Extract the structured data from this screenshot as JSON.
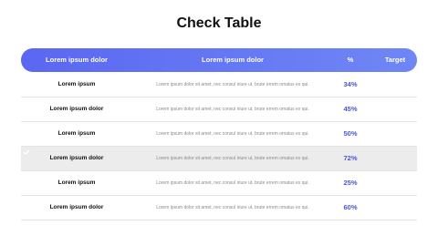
{
  "title": "Check Table",
  "header": {
    "col1": "Lorem ipsum dolor",
    "col2": "Lorem ipsum dolor",
    "col3": "%",
    "col4": "Target"
  },
  "rows": [
    {
      "label": "Lorem ipsum",
      "description": "Lorem ipsum dolor sit amet, nec consul iriure ut, brute errem omatus ex qui.",
      "percent": "34%",
      "target": true
    },
    {
      "label": "Lorem ipsum dolor",
      "description": "Lorem ipsum dolor sit amet, nec consul iriure ut, brute errem omatus ex qui.",
      "percent": "45%",
      "target": true
    },
    {
      "label": "Lorem ipsum",
      "description": "Lorem ipsum dolor sit amet, nec consul iriure ut, brute errem omatus ex qui.",
      "percent": "50%",
      "target": false
    },
    {
      "label": "Lorem ipsum dolor",
      "description": "Lorem ipsum dolor sit amet, nec consul iriure ut, brute errem omatus ex qui.",
      "percent": "72%",
      "target": true
    },
    {
      "label": "Lorem ipsum",
      "description": "Lorem ipsum dolor sit amet, nec consul iriure ut, brute errem omatus ex qui.",
      "percent": "25%",
      "target": true
    },
    {
      "label": "Lorem ipsum dolor",
      "description": "Lorem ipsum dolor sit amet, nec consul iriure ut, brute errem omatus ex qui.",
      "percent": "60%",
      "target": false
    }
  ],
  "colors": {
    "accent": "#5563e6",
    "inactive": "#d9d9d9"
  },
  "icons": {
    "check": "check-circle-icon"
  }
}
